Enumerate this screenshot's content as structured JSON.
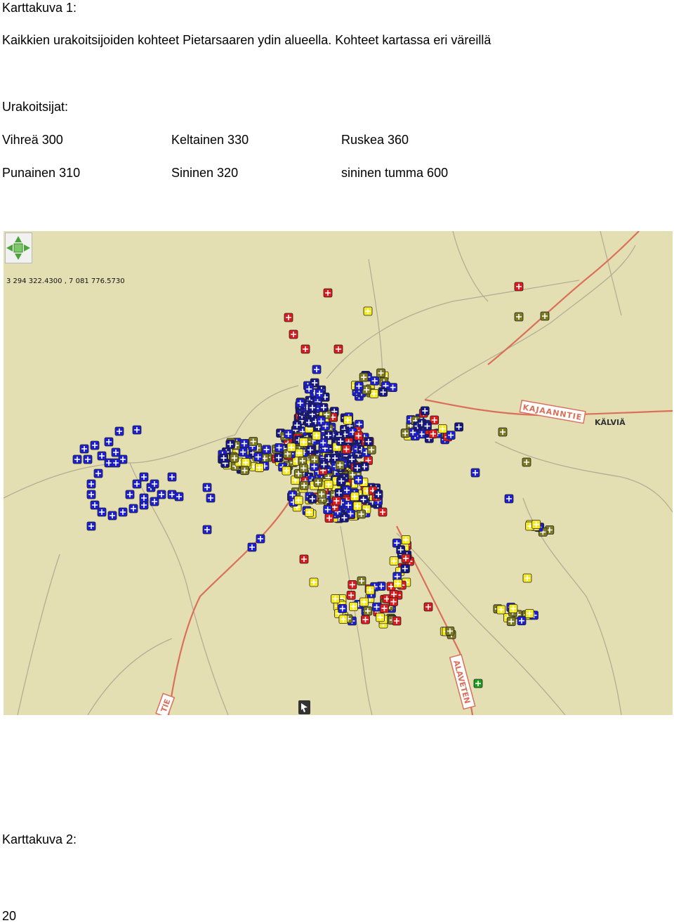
{
  "caption_1": "Karttakuva 1:",
  "intro": "Kaikkien urakoitsijoiden kohteet Pietarsaaren ydin alueella. Kohteet kartassa eri väreillä",
  "contractors_heading": "Urakoitsijat:",
  "legend": [
    {
      "label": "Vihreä 300",
      "color": "#1d9e1d"
    },
    {
      "label": "Keltainen 330",
      "color": "#f6ea1f"
    },
    {
      "label": "Ruskea 360",
      "color": "#7d7a20"
    },
    {
      "label": "Punainen 310",
      "color": "#e0191d"
    },
    {
      "label": "Sininen 320",
      "color": "#1b1ed6"
    },
    {
      "label": "sininen tumma 600",
      "color": "#15158a"
    }
  ],
  "map": {
    "coordinate_readout": "3 294 322.4300 , 7 081 776.5730",
    "road_labels": [
      "KAJAANNTIE",
      "KÄLVIÄ",
      "ALAVETEN",
      "TIE"
    ],
    "background_color": "#e4dfb3",
    "road_color": "#d9705a",
    "minor_road_color": "#b5ac94",
    "marker_icon": "cross-marker-icon",
    "pan_widget_icon": "pan-compass-icon",
    "cursor_icon": "map-cursor-icon"
  },
  "caption_2": "Karttakuva 2:",
  "page_number": "20"
}
